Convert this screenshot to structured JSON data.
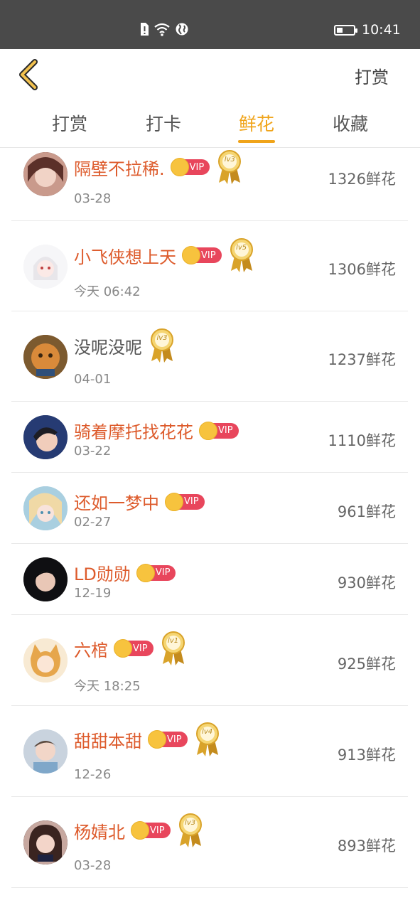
{
  "status_bar": {
    "time": "10:41",
    "battery_level": 0.35
  },
  "header": {
    "back_icon": "chevron-left-icon",
    "action_label": "打赏"
  },
  "tabs": [
    {
      "label": "打赏",
      "active": false
    },
    {
      "label": "打卡",
      "active": false
    },
    {
      "label": "鲜花",
      "active": true
    },
    {
      "label": "收藏",
      "active": false
    }
  ],
  "colors": {
    "accent": "#f0a41a",
    "vip_name": "#dd5b2c",
    "vip_badge": "#e8465c",
    "status_bar": "#4a4a4a"
  },
  "vip_label": "VIP",
  "list": [
    {
      "name": "隔壁不拉稀.",
      "vip": true,
      "level": "lv3",
      "date": "03-28",
      "count": "1326鲜花"
    },
    {
      "name": "小飞侠想上天",
      "vip": true,
      "level": "lv5",
      "date": "今天 06:42",
      "count": "1306鲜花"
    },
    {
      "name": "没呢没呢",
      "vip": false,
      "level": "lv3",
      "date": "04-01",
      "count": "1237鲜花"
    },
    {
      "name": "骑着摩托找花花",
      "vip": true,
      "level": null,
      "date": "03-22",
      "count": "1110鲜花"
    },
    {
      "name": "还如一梦中",
      "vip": true,
      "level": null,
      "date": "02-27",
      "count": "961鲜花"
    },
    {
      "name": "LD勋勋",
      "vip": true,
      "level": null,
      "date": "12-19",
      "count": "930鲜花"
    },
    {
      "name": "六棺",
      "vip": true,
      "level": "lv1",
      "date": "今天 18:25",
      "count": "925鲜花"
    },
    {
      "name": "甜甜本甜",
      "vip": true,
      "level": "lv4",
      "date": "12-26",
      "count": "913鲜花"
    },
    {
      "name": "杨婧北",
      "vip": true,
      "level": "lv3",
      "date": "03-28",
      "count": "893鲜花"
    }
  ]
}
